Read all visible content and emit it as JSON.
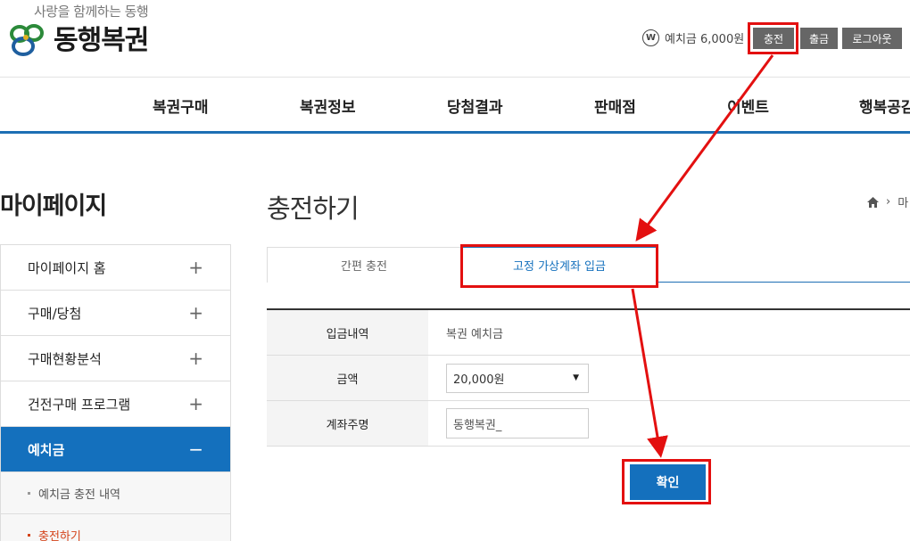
{
  "header": {
    "tagline": "사랑을 함께하는 동행",
    "logo_text": "동행복권",
    "balance_icon": "W",
    "balance_text": "예치금 6,000원",
    "buttons": {
      "charge": "충전",
      "withdraw": "출금",
      "logout": "로그아웃"
    }
  },
  "gnb": [
    "복권구매",
    "복권정보",
    "당첨결과",
    "판매점",
    "이벤트",
    "행복공감"
  ],
  "sidebar": {
    "title": "마이페이지",
    "items": [
      {
        "label": "마이페이지 홈",
        "toggle": "+"
      },
      {
        "label": "구매/당첨",
        "toggle": "+"
      },
      {
        "label": "구매현황분석",
        "toggle": "+"
      },
      {
        "label": "건전구매 프로그램",
        "toggle": "+"
      },
      {
        "label": "예치금",
        "toggle": "−"
      }
    ],
    "subitems": [
      "예치금 충전 내역",
      "충전하기"
    ]
  },
  "main": {
    "title": "충전하기",
    "breadcrumb": "마",
    "tabs": [
      "간편 충전",
      "고정 가상계좌 입금"
    ],
    "rows": [
      {
        "label": "입금내역",
        "value": "복권 예치금"
      },
      {
        "label": "금액",
        "value": "20,000원"
      },
      {
        "label": "계좌주명",
        "value": "동행복권_"
      }
    ],
    "confirm": "확인"
  },
  "colors": {
    "brand_blue": "#1470bd",
    "highlight": "#e31010",
    "current_submenu": "#d4431a"
  }
}
